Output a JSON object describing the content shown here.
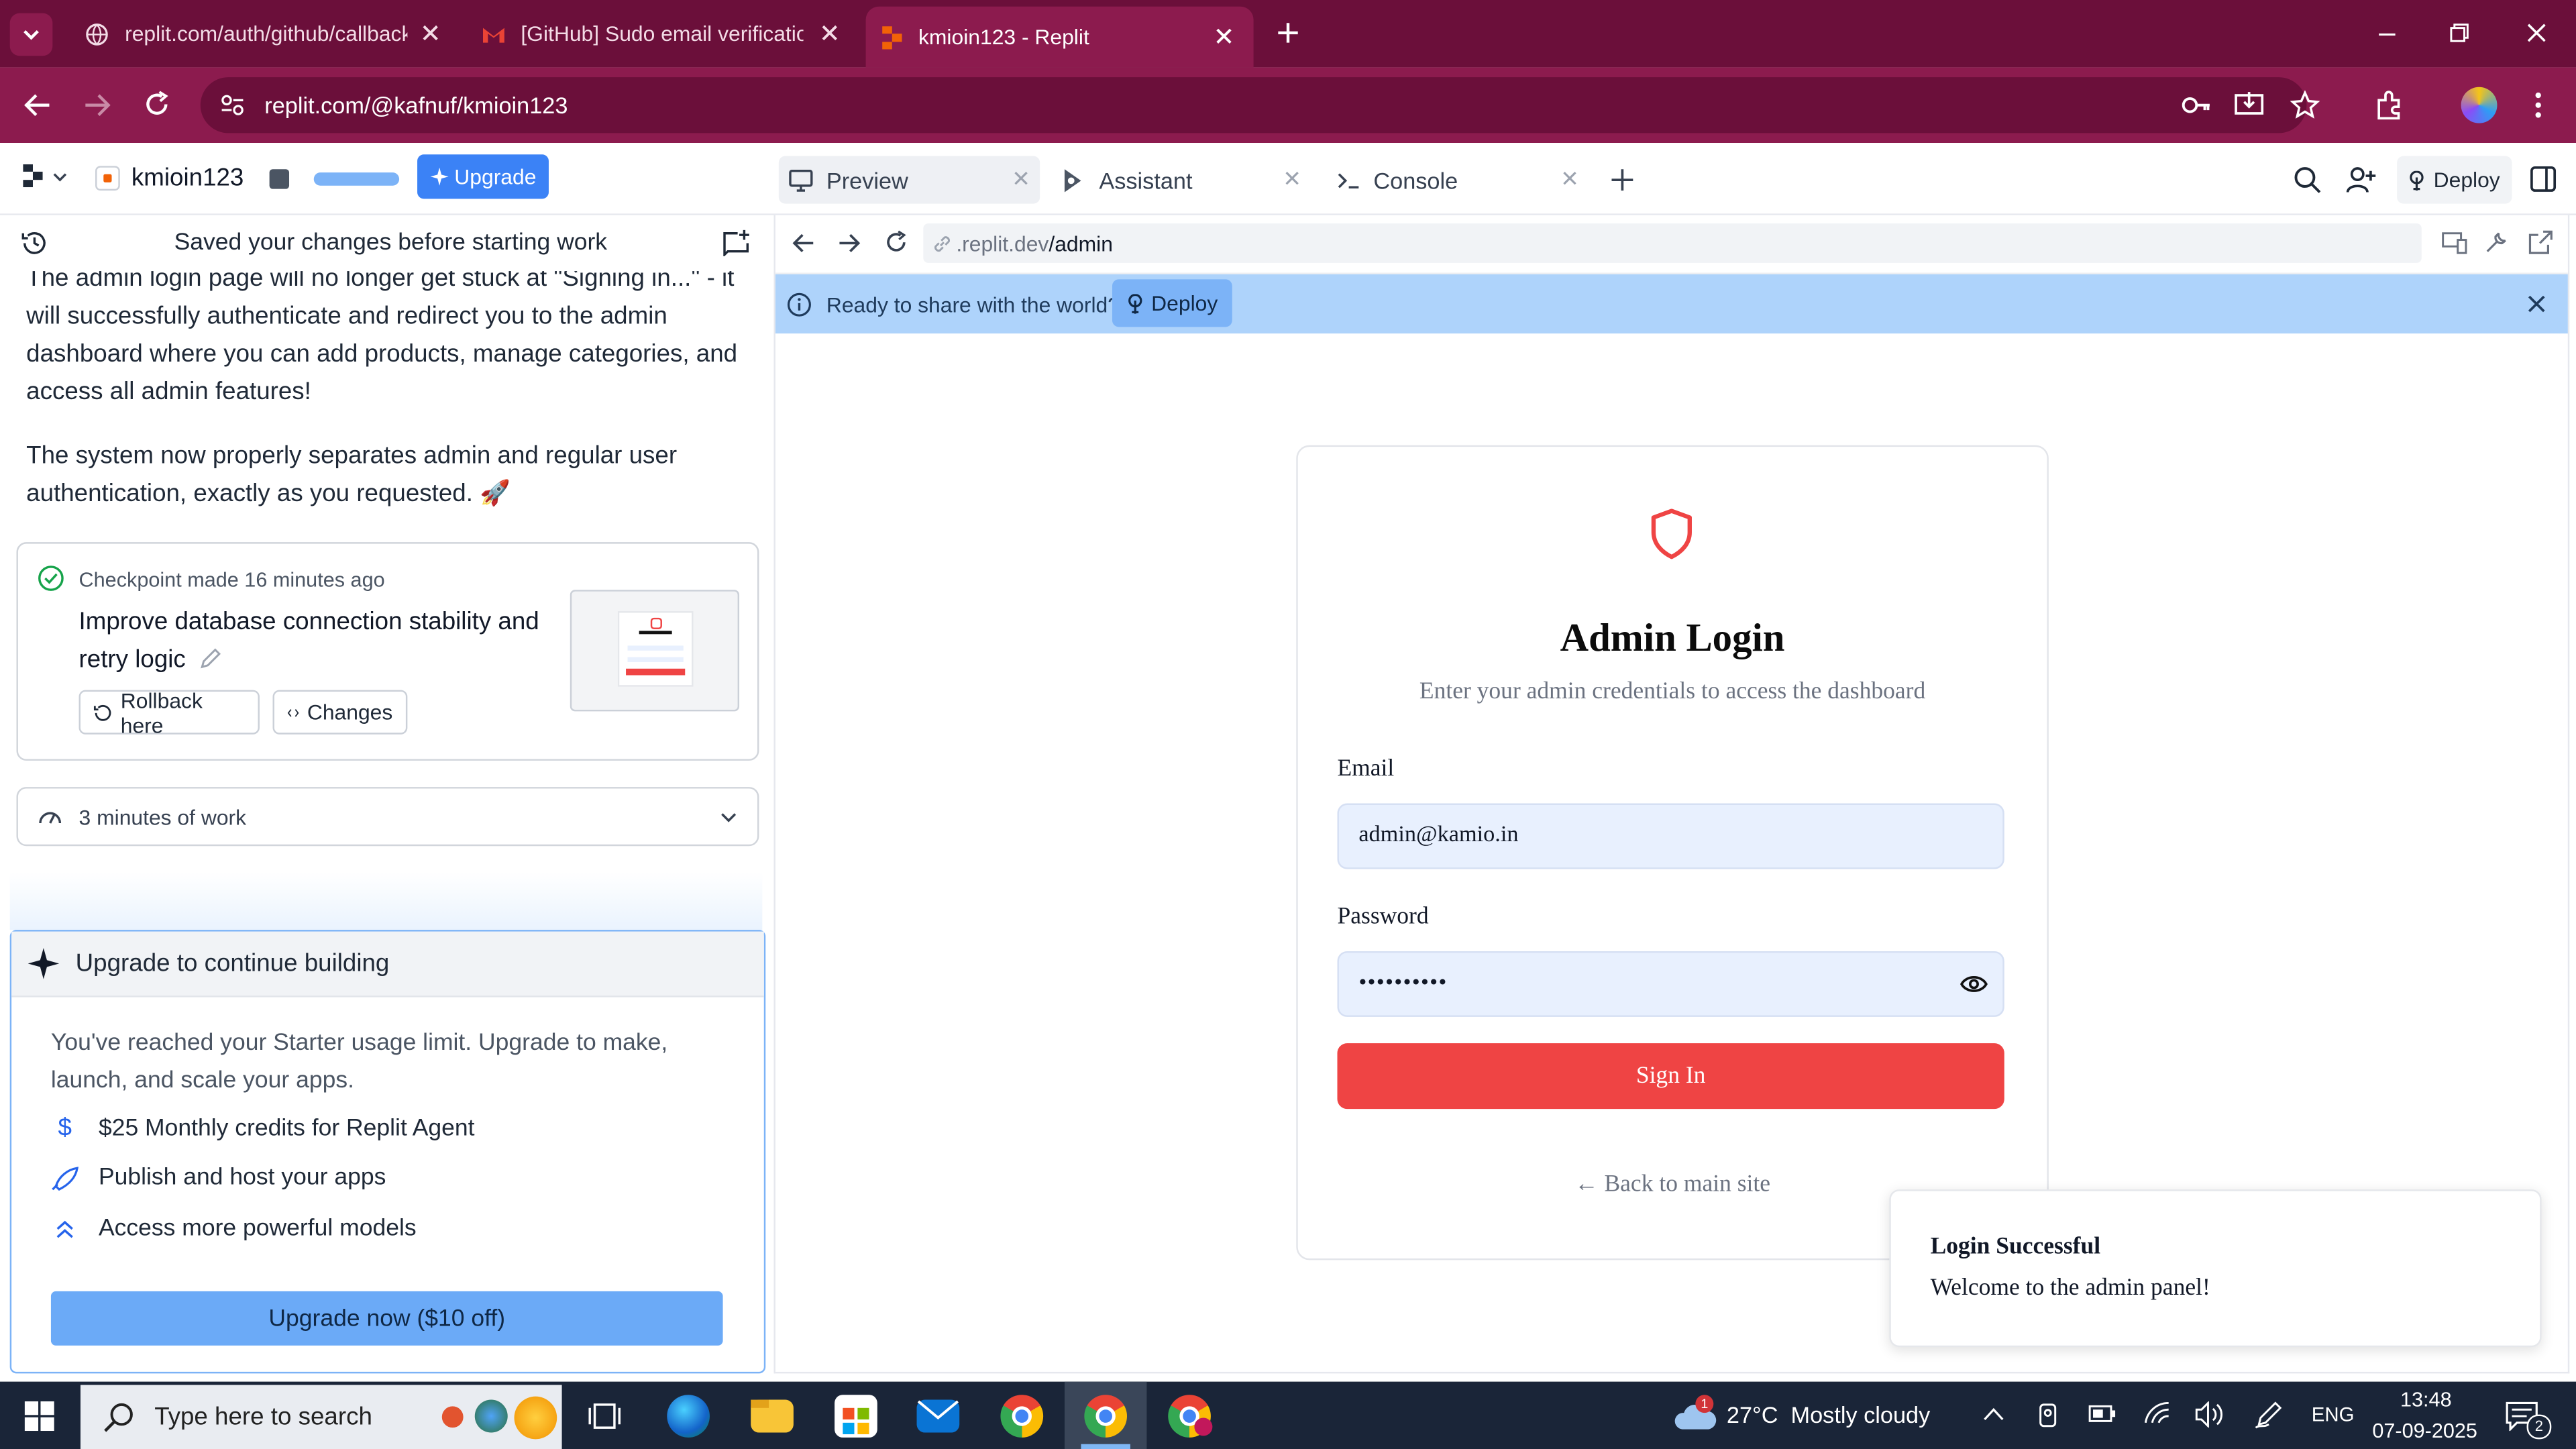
{
  "browser": {
    "tabs": [
      {
        "title": "replit.com/auth/github/callback"
      },
      {
        "title": "[GitHub] Sudo email verification"
      },
      {
        "title": "kmioin123 - Replit"
      }
    ],
    "url": "replit.com/@kafnuf/kmioin123"
  },
  "header": {
    "project_name": "kmioin123",
    "upgrade_label": "Upgrade",
    "pane_tabs": [
      {
        "label": "Preview"
      },
      {
        "label": "Assistant"
      },
      {
        "label": "Console"
      }
    ],
    "deploy_label": "Deploy"
  },
  "chat": {
    "saved_banner": "Saved your changes before starting work",
    "message_1": "The admin login page will no longer get stuck at \"Signing in...\" - it will successfully authenticate and redirect you to the admin dashboard where you can add products, manage categories, and access all admin features!",
    "message_2": "The system now properly separates admin and regular user authentication, exactly as you requested. 🚀",
    "checkpoint": {
      "meta": "Checkpoint made 16 minutes ago",
      "title": "Improve database connection stability and retry logic",
      "rollback_label": "Rollback here",
      "changes_label": "Changes"
    },
    "work_summary": "3 minutes of work",
    "upgrade_card": {
      "title": "Upgrade to continue building",
      "text": "You've reached your Starter usage limit. Upgrade to make, launch, and scale your apps.",
      "features": [
        {
          "label": "$25 Monthly credits for Replit Agent",
          "icon": "dollar-icon"
        },
        {
          "label": "Publish and host your apps",
          "icon": "rocket-icon"
        },
        {
          "label": "Access more powerful models",
          "icon": "double-chevron-up-icon"
        }
      ],
      "button_label": "Upgrade now ($10 off)"
    }
  },
  "preview": {
    "url_prefix": ".replit.dev",
    "url_path": "/admin",
    "banner_text": "Ready to share with the world?",
    "banner_button": "Deploy",
    "login": {
      "title": "Admin Login",
      "subtitle": "Enter your admin credentials to access the dashboard",
      "email_label": "Email",
      "email_value": "admin@kamio.in",
      "password_label": "Password",
      "password_value": "••••••••••",
      "signin_label": "Sign In",
      "back_link": "← Back to main site"
    },
    "toast": {
      "title": "Login Successful",
      "message": "Welcome to the admin panel!"
    }
  },
  "taskbar": {
    "search_placeholder": "Type here to search",
    "weather": "27°C  Mostly cloudy",
    "weather_badge": "1",
    "language": "ENG",
    "time": "13:48",
    "date": "07-09-2025",
    "notification_count": "2"
  },
  "colors": {
    "browser_frame": "#6b0f3a",
    "browser_toolbar": "#8c1b4e",
    "replit_blue": "#3b82f6",
    "signin_red": "#ef4444",
    "banner_blue": "#aed3fb"
  }
}
